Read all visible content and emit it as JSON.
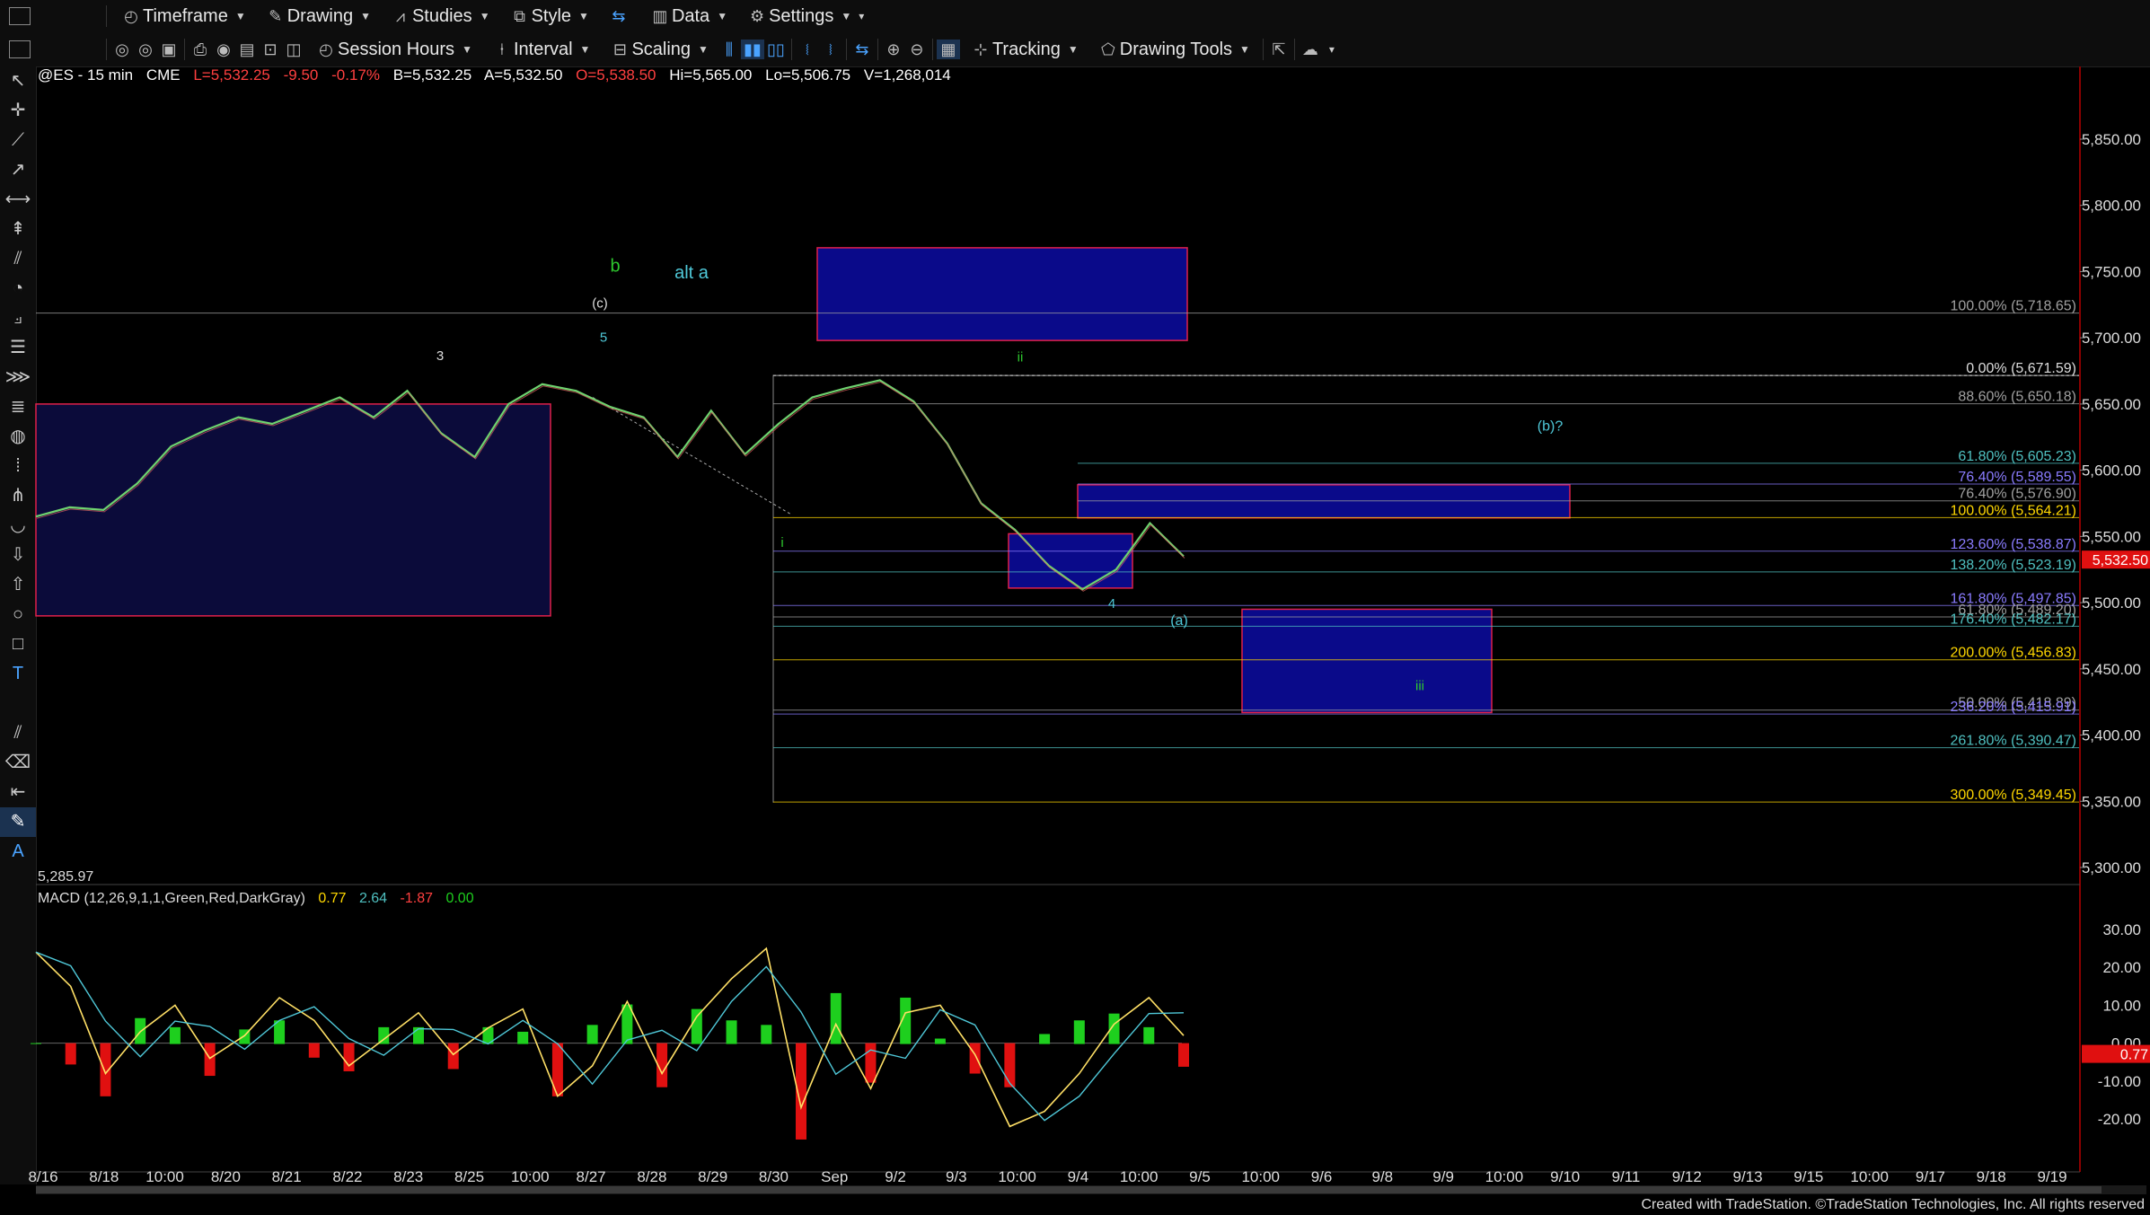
{
  "toolbar1": {
    "timeframe": "Timeframe",
    "drawing": "Drawing",
    "studies": "Studies",
    "style": "Style",
    "data": "Data",
    "settings": "Settings"
  },
  "toolbar2": {
    "session_hours": "Session Hours",
    "interval": "Interval",
    "scaling": "Scaling",
    "tracking": "Tracking",
    "drawing_tools": "Drawing Tools"
  },
  "symbol_bar": {
    "symbol": "@ES - 15 min",
    "exchange": "CME",
    "last": "L=5,532.25",
    "change": "-9.50",
    "change_pct": "-0.17%",
    "bid": "B=5,532.25",
    "ask": "A=5,532.50",
    "open": "O=5,538.50",
    "high": "Hi=5,565.00",
    "low": "Lo=5,506.75",
    "volume": "V=1,268,014"
  },
  "colors": {
    "negative": "#ff4040",
    "fib_gray": "#a0a0a0",
    "fib_yellow": "#ffd700",
    "fib_teal": "#4fc0c0",
    "fib_purple": "#8a7cff",
    "box_fill": "#0a0a8a",
    "box_border": "#e0204a",
    "macd_green": "#1ecf1e",
    "macd_red": "#e01010"
  },
  "chart_data": {
    "type": "line",
    "title": "@ES - 15 min",
    "price_axis": {
      "ylim": [
        5285,
        5895
      ],
      "ticks": [
        "5,850.00",
        "5,800.00",
        "5,750.00",
        "5,700.00",
        "5,650.00",
        "5,600.00",
        "5,550.00",
        "5,500.00",
        "5,450.00",
        "5,400.00",
        "5,350.00",
        "5,300.00"
      ]
    },
    "current_price": "5,532.50",
    "low_label": "5,285.97",
    "x_ticks": [
      "8/16",
      "8/18",
      "10:00",
      "8/20",
      "8/21",
      "8/22",
      "8/23",
      "8/25",
      "10:00",
      "8/27",
      "8/28",
      "8/29",
      "8/30",
      "Sep",
      "9/2",
      "9/3",
      "10:00",
      "9/4",
      "10:00",
      "9/5",
      "10:00",
      "9/6",
      "9/8",
      "9/9",
      "10:00",
      "9/10",
      "9/11",
      "9/12",
      "9/13",
      "9/15",
      "10:00",
      "9/17",
      "9/18",
      "9/19"
    ],
    "fib_levels": [
      {
        "label": "100.00% (5,718.65)",
        "price": 5718.65,
        "color": "gray"
      },
      {
        "label": "0.00% (5,671.59)",
        "price": 5671.59,
        "color": "white"
      },
      {
        "label": "88.60% (5,650.18)",
        "price": 5650.18,
        "color": "gray"
      },
      {
        "label": "61.80% (5,605.23)",
        "price": 5605.23,
        "color": "teal"
      },
      {
        "label": "76.40% (5,589.55)",
        "price": 5589.55,
        "color": "purple"
      },
      {
        "label": "76.40% (5,576.90)",
        "price": 5576.9,
        "color": "gray"
      },
      {
        "label": "100.00% (5,564.21)",
        "price": 5564.21,
        "color": "yellow"
      },
      {
        "label": "123.60% (5,538.87)",
        "price": 5538.87,
        "color": "purple"
      },
      {
        "label": "138.20% (5,523.19)",
        "price": 5523.19,
        "color": "teal"
      },
      {
        "label": "161.80% (5,497.85)",
        "price": 5497.85,
        "color": "purple"
      },
      {
        "label": "61.80% (5,489.20)",
        "price": 5489.2,
        "color": "gray"
      },
      {
        "label": "176.40% (5,482.17)",
        "price": 5482.17,
        "color": "teal"
      },
      {
        "label": "200.00% (5,456.83)",
        "price": 5456.83,
        "color": "yellow"
      },
      {
        "label": "50.00% (5,418.89)",
        "price": 5418.89,
        "color": "gray"
      },
      {
        "label": "236.20% (5,415.91)",
        "price": 5415.91,
        "color": "purple"
      },
      {
        "label": "261.80% (5,390.47)",
        "price": 5390.47,
        "color": "teal"
      },
      {
        "label": "300.00% (5,349.45)",
        "price": 5349.45,
        "color": "yellow"
      }
    ],
    "wave_labels": [
      {
        "text": "b",
        "color": "green"
      },
      {
        "text": "alt a",
        "color": "teal"
      },
      {
        "text": "(c)",
        "color": "white"
      },
      {
        "text": "5",
        "color": "teal"
      },
      {
        "text": "3",
        "color": "white"
      },
      {
        "text": "ii",
        "color": "green"
      },
      {
        "text": "i",
        "color": "green"
      },
      {
        "text": "4",
        "color": "teal"
      },
      {
        "text": "(a)",
        "color": "teal"
      },
      {
        "text": "(b)?",
        "color": "teal"
      },
      {
        "text": "iii",
        "color": "green"
      }
    ],
    "price_series_approx": [
      5565,
      5572,
      5570,
      5590,
      5618,
      5630,
      5640,
      5635,
      5645,
      5655,
      5640,
      5660,
      5628,
      5610,
      5650,
      5665,
      5660,
      5648,
      5640,
      5610,
      5645,
      5612,
      5635,
      5655,
      5662,
      5668,
      5652,
      5620,
      5575,
      5555,
      5528,
      5510,
      5525,
      5560,
      5535
    ]
  },
  "macd": {
    "label": "MACD (12,26,9,1,1,Green,Red,DarkGray)",
    "v1": "0.77",
    "v2": "2.64",
    "v3": "-1.87",
    "v4": "0.00",
    "ylim": [
      -25,
      35
    ],
    "ticks": [
      "30.00",
      "20.00",
      "10.00",
      "0.00",
      "-10.00",
      "-20.00"
    ],
    "current": "0.77",
    "line_series_approx": [
      24,
      15,
      -8,
      3,
      10,
      -4,
      2,
      12,
      6,
      -6,
      1,
      8,
      -3,
      4,
      9,
      -14,
      -6,
      11,
      -8,
      7,
      17,
      25,
      -17,
      5,
      -12,
      8,
      10,
      -3,
      -22,
      -18,
      -8,
      5,
      12,
      2
    ]
  },
  "footer": "Created with TradeStation. ©TradeStation Technologies, Inc. All rights reserved"
}
